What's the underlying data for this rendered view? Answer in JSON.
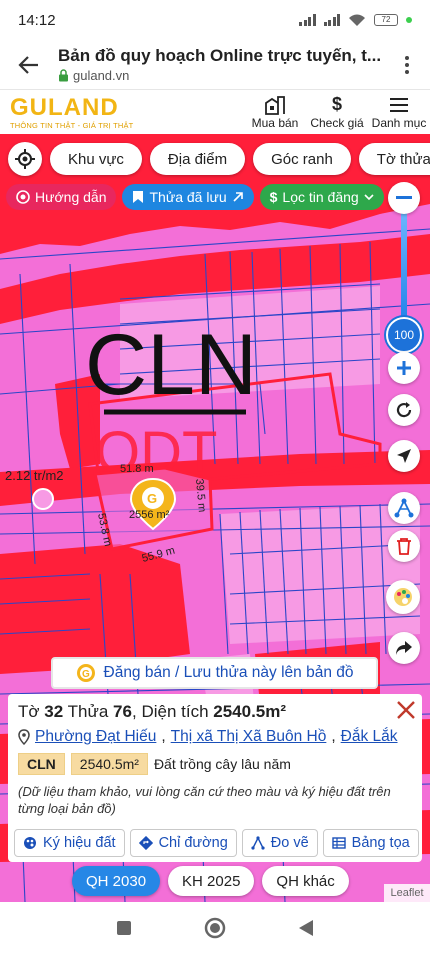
{
  "status": {
    "time": "14:12",
    "battery": "72"
  },
  "browser": {
    "title": "Bản đồ quy hoạch Online trực tuyến, t...",
    "domain": "guland.vn"
  },
  "header": {
    "logo": "GULAND",
    "tagline": "THÔNG TIN THẬT - GIÁ TRỊ THẬT",
    "nav": [
      {
        "label": "Mua bán",
        "icon": "building-icon"
      },
      {
        "label": "Check giá",
        "icon": "dollar-icon"
      },
      {
        "label": "Danh mục",
        "icon": "menu-icon"
      }
    ]
  },
  "filters": [
    "Khu vực",
    "Địa điểm",
    "Góc ranh",
    "Tờ thửa"
  ],
  "pills": {
    "guide": "Hướng dẫn",
    "saved": "Thửa đã lưu",
    "filter": "Lọc tin đăng"
  },
  "map": {
    "zone_primary": "CLN",
    "zone_secondary": "ODT",
    "price_label": "2.12 tr/m2",
    "parcel_area_label": "2556 m²",
    "edge_top": "51.8 m",
    "edge_right": "39.5 m",
    "edge_left": "53.8 m",
    "edge_bottom": "55.9 m",
    "zoom": "100",
    "colors": {
      "land": "#f36fd7",
      "red_zone": "#ff1f3a",
      "parcel_lines": "#2b46c8",
      "zoom": "#1d72d9"
    }
  },
  "post_button": "Đăng bán / Lưu thửa này lên bản đồ",
  "info": {
    "sheet_label": "Tờ",
    "sheet": "32",
    "parcel_label": "Thửa",
    "parcel": "76",
    "area_label": "Diện tích",
    "area": "2540.5m²",
    "ward": "Phường Đạt Hiếu",
    "town": "Thị xã Thị Xã Buôn Hồ",
    "province": "Đắk Lắk",
    "land_code": "CLN",
    "land_area": "2540.5m²",
    "land_desc": "Đất trồng cây lâu năm",
    "note": "(Dữ liệu tham khảo, vui lòng căn cứ theo màu và ký hiệu đất trên từng loại bản đồ)",
    "actions": [
      "Ký hiệu đất",
      "Chỉ đường",
      "Đo vẽ",
      "Bảng tọa"
    ]
  },
  "plan_tabs": [
    "QH 2030",
    "KH 2025",
    "QH khác"
  ],
  "attribution": "Leaflet"
}
